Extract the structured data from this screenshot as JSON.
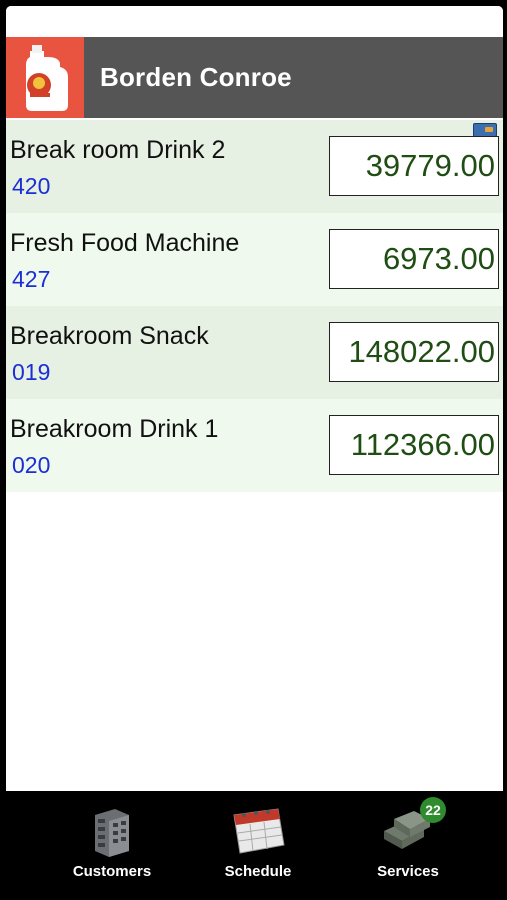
{
  "header": {
    "title": "Borden Conroe"
  },
  "machines": [
    {
      "name": "Break room Drink 2",
      "code": "420",
      "value": "39779.00"
    },
    {
      "name": "Fresh Food Machine",
      "code": "427",
      "value": "6973.00"
    },
    {
      "name": "Breakroom Snack",
      "code": "019",
      "value": "148022.00"
    },
    {
      "name": "Breakroom Drink 1",
      "code": "020",
      "value": "112366.00"
    }
  ],
  "tabs": [
    {
      "label": "Customers",
      "icon": "building-icon"
    },
    {
      "label": "Schedule",
      "icon": "calendar-icon"
    },
    {
      "label": "Services",
      "icon": "cash-stack-icon",
      "badge": "22"
    }
  ],
  "colors": {
    "header_bg": "#555555",
    "logo_bg": "#e8543f",
    "code_text": "#1b2fd6",
    "value_text": "#1f4d13",
    "badge_bg": "#2e8b2e"
  }
}
